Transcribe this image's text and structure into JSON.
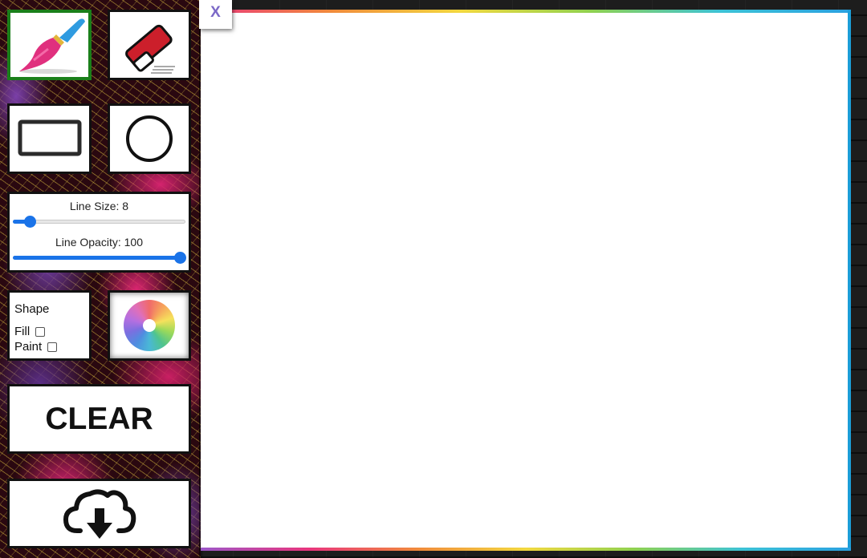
{
  "tools": {
    "brush_icon": "paintbrush-icon",
    "eraser_icon": "eraser-icon",
    "rectangle_icon": "rectangle-icon",
    "circle_icon": "circle-icon",
    "active_tool": "brush"
  },
  "line_settings": {
    "size_label": "Line Size: 8",
    "size_value": 8,
    "size_min": 1,
    "size_max": 100,
    "opacity_label": "Line Opacity: 100",
    "opacity_value": 100,
    "opacity_min": 0,
    "opacity_max": 100
  },
  "shape_options": {
    "title": "Shape",
    "fill_label": "Fill",
    "fill_checked": false,
    "paint_label": "Paint",
    "paint_checked": false
  },
  "color_picker": {
    "icon": "color-wheel-icon"
  },
  "actions": {
    "clear_label": "CLEAR",
    "download_icon": "cloud-download-icon"
  },
  "close_label": "X",
  "colors": {
    "active_border": "#1a7f1a",
    "slider_accent": "#1a73e8",
    "close_text": "#7b68c7",
    "eraser_red": "#cc1f2b",
    "brush_pink": "#e0307e",
    "brush_blue": "#2f9be0"
  }
}
